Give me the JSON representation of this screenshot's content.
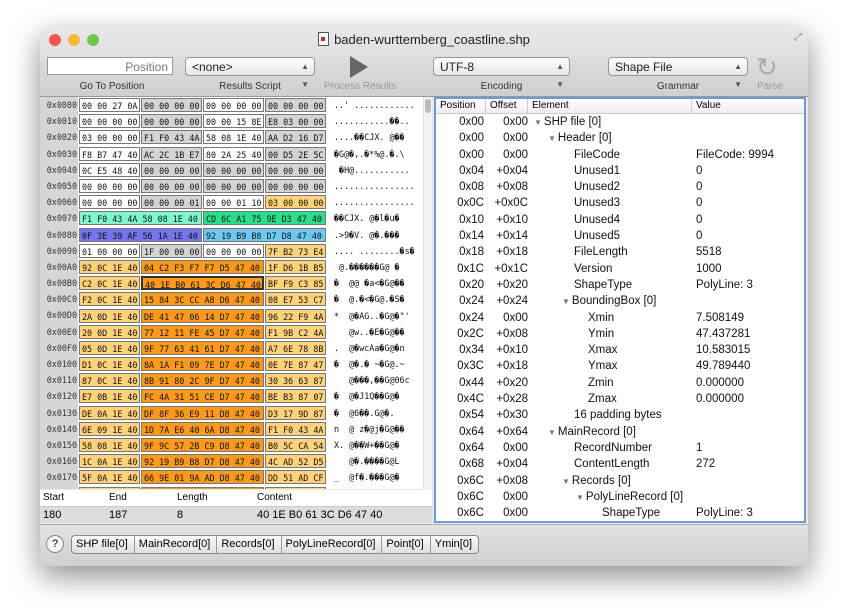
{
  "window": {
    "title": "baden-wurttemberg_coastline.shp"
  },
  "toolbar": {
    "position_placeholder": "Position",
    "go_to_label": "Go To Position",
    "results_script_value": "<none>",
    "results_script_label": "Results Script",
    "process_label": "Process Results",
    "encoding_value": "UTF-8",
    "encoding_label": "Encoding",
    "grammar_value": "Shape File",
    "grammar_label": "Grammar",
    "parse_label": "Parse"
  },
  "colors": {
    "w": "#ffffff",
    "g": "#d4d4d4",
    "y": "#fdd27a",
    "o": "#fb9a1a",
    "teal": "#80f5d2",
    "green": "#28e08c",
    "purple": "#7474ee",
    "lblue": "#70c8f2",
    "accent": "#6f9ad3"
  },
  "hex_rows": [
    {
      "addr": "0x0000",
      "groups": [
        "00 00 27 0A",
        "00 00 00 00",
        "00 00 00 00",
        "00 00 00 00"
      ],
      "colors": [
        "w",
        "g",
        "w",
        "g"
      ],
      "ascii": "..' ............"
    },
    {
      "addr": "0x0010",
      "groups": [
        "00 00 00 00",
        "00 00 00 00",
        "00 00 15 8E",
        "E8 03 00 00"
      ],
      "colors": [
        "w",
        "g",
        "w",
        "g"
      ],
      "ascii": "...........��.."
    },
    {
      "addr": "0x0020",
      "groups": [
        "03 00 00 00",
        "F1 F0 43 4A",
        "58 08 1E 40",
        "AA D2 16 D7"
      ],
      "colors": [
        "w",
        "g",
        "w",
        "g"
      ],
      "ascii": "....��CJX. @��"
    },
    {
      "addr": "0x0030",
      "groups": [
        "F8 B7 47 40",
        "AC 2C 1B E7",
        "80 2A 25 40",
        "00 D5 2E 5C"
      ],
      "colors": [
        "w",
        "g",
        "w",
        "g"
      ],
      "ascii": "�G@�,.�*%@.�.\\"
    },
    {
      "addr": "0x0040",
      "groups": [
        "0C E5 48 40",
        "00 00 00 00",
        "00 00 00 00",
        "00 00 00 00"
      ],
      "colors": [
        "w",
        "g",
        "g",
        "g"
      ],
      "ascii": " �H@..........."
    },
    {
      "addr": "0x0050",
      "groups": [
        "00 00 00 00",
        "00 00 00 00",
        "00 00 00 00",
        "00 00 00 00"
      ],
      "colors": [
        "w",
        "g",
        "g",
        "g"
      ],
      "ascii": "................"
    },
    {
      "addr": "0x0060",
      "groups": [
        "00 00 00 00",
        "00 00 00 01",
        "00 00 01 10",
        "03 00 00 00"
      ],
      "colors": [
        "w",
        "g",
        "w",
        "y"
      ],
      "ascii": "................"
    },
    {
      "addr": "0x0070",
      "groups": [
        "F1 F0 43 4A 58 08 1E 40",
        "CD 6C A1 75 9E D3 47 40"
      ],
      "colors": [
        "teal",
        "green"
      ],
      "ascii": "��CJX. @�l�u�"
    },
    {
      "addr": "0x0080",
      "groups": [
        "0F 3E 39 AF 56 1A 1E 40",
        "92 19 B9 B8 D7 D8 47 40"
      ],
      "colors": [
        "purple",
        "lblue"
      ],
      "ascii": ".>9�V. @�.���"
    },
    {
      "addr": "0x0090",
      "groups": [
        "01 00 00 00",
        "1F 00 00 00",
        "00 00 00 00",
        "7F B2 73 E4"
      ],
      "colors": [
        "w",
        "g",
        "w",
        "y"
      ],
      "ascii": ".... ........�s�"
    },
    {
      "addr": "0x00A0",
      "groups": [
        "92 0C 1E 40",
        "04 C2 F3 F7 F7 D5 47 40",
        "1F D6 1B B5"
      ],
      "colors": [
        "y",
        "o",
        "y"
      ],
      "ascii": " @.������G@ �"
    },
    {
      "addr": "0x00B0",
      "groups": [
        "C2 0C 1E 40",
        "40 1E B0 61 3C D6 47 40",
        "BF F9 C3 85"
      ],
      "colors": [
        "y",
        "o",
        "y"
      ],
      "ascii": "�  @@ �a<�G@��",
      "selected": true
    },
    {
      "addr": "0x00C0",
      "groups": [
        "F2 0C 1E 40",
        "15 84 3C CC A8 D6 47 40",
        "08 E7 53 C7"
      ],
      "colors": [
        "y",
        "o",
        "y"
      ],
      "ascii": "�  @.�<�G@.�S�"
    },
    {
      "addr": "0x00D0",
      "groups": [
        "2A 0D 1E 40",
        "DE 41 47 06 14 D7 47 40",
        "96 22 F9 4A"
      ],
      "colors": [
        "y",
        "o",
        "y"
      ],
      "ascii": "*  @�AG..�G@�\"'"
    },
    {
      "addr": "0x00E0",
      "groups": [
        "20 0D 1E 40",
        "77 12 11 FE 45 D7 47 40",
        "F1 9B C2 4A"
      ],
      "colors": [
        "y",
        "o",
        "y"
      ],
      "ascii": "   @w..�E�G@��"
    },
    {
      "addr": "0x00F0",
      "groups": [
        "05 0D 1E 40",
        "9F 77 63 41 61 D7 47 40",
        "A7 6E 78 8B"
      ],
      "colors": [
        "y",
        "o",
        "y"
      ],
      "ascii": ".  @�wcAa�G@�n"
    },
    {
      "addr": "0x0100",
      "groups": [
        "D1 0C 1E 40",
        "8A 1A F1 09 7E D7 47 40",
        "0E 7E 87 47"
      ],
      "colors": [
        "y",
        "o",
        "y"
      ],
      "ascii": "�  @�.� ~�G@.~"
    },
    {
      "addr": "0x0110",
      "groups": [
        "87 0C 1E 40",
        "8B 91 80 2C 9F D7 47 40",
        "30 36 63 87"
      ],
      "colors": [
        "y",
        "o",
        "y"
      ],
      "ascii": "   @���,��G@06c"
    },
    {
      "addr": "0x0120",
      "groups": [
        "E7 0B 1E 40",
        "FC 4A 31 51 CE D7 47 40",
        "BE B3 87 07"
      ],
      "colors": [
        "y",
        "o",
        "y"
      ],
      "ascii": "�  @�J1Q��G@�"
    },
    {
      "addr": "0x0130",
      "groups": [
        "DE 0A 1E 40",
        "DF 8F 36 E9 11 D8 47 40",
        "D3 17 9D 87"
      ],
      "colors": [
        "y",
        "o",
        "y"
      ],
      "ascii": "�  @6��.G@�."
    },
    {
      "addr": "0x0140",
      "groups": [
        "6E 09 1E 40",
        "1D 7A E6 40 6A D8 47 40",
        "F1 F0 43 4A"
      ],
      "colors": [
        "y",
        "o",
        "y"
      ],
      "ascii": "n  @ z�@j�G@��"
    },
    {
      "addr": "0x0150",
      "groups": [
        "58 08 1E 40",
        "9F 9C 57 2B C9 D8 47 40",
        "B0 5C CA 54"
      ],
      "colors": [
        "y",
        "o",
        "y"
      ],
      "ascii": "X. @��W+��G@�"
    },
    {
      "addr": "0x0160",
      "groups": [
        "1C 0A 1E 40",
        "92 19 B9 B8 D7 D8 47 40",
        "4C AD 52 D5"
      ],
      "colors": [
        "y",
        "o",
        "y"
      ],
      "ascii": "   @�.����G@L"
    },
    {
      "addr": "0x0170",
      "groups": [
        "5F 0A 1E 40",
        "66 9E 01 9A AD D8 47 40",
        "DD 51 AD CF"
      ],
      "colors": [
        "y",
        "o",
        "y"
      ],
      "ascii": "_  @f�.���G@�"
    },
    {
      "addr": "0x0180",
      "groups": [
        "E6 0A 1E 40",
        "E4 E4 34 FA 87 D8 47 40",
        "F5 17 D5 7D"
      ],
      "colors": [
        "y",
        "o",
        "y"
      ],
      "ascii": "�  @��4��G@."
    }
  ],
  "tree": {
    "headers": [
      "Position",
      "Offset",
      "Element",
      "Value"
    ],
    "rows": [
      {
        "pos": "0x00",
        "off": "0x00",
        "name": "SHP file [0]",
        "value": "",
        "level": 0,
        "expanded": true
      },
      {
        "pos": "0x00",
        "off": "0x00",
        "name": "Header [0]",
        "value": "",
        "level": 1,
        "expanded": true
      },
      {
        "pos": "0x00",
        "off": "0x00",
        "name": "FileCode",
        "value": "FileCode: 9994",
        "level": 2
      },
      {
        "pos": "0x04",
        "off": "+0x04",
        "name": "Unused1",
        "value": "0",
        "level": 2
      },
      {
        "pos": "0x08",
        "off": "+0x08",
        "name": "Unused2",
        "value": "0",
        "level": 2
      },
      {
        "pos": "0x0C",
        "off": "+0x0C",
        "name": "Unused3",
        "value": "0",
        "level": 2
      },
      {
        "pos": "0x10",
        "off": "+0x10",
        "name": "Unused4",
        "value": "0",
        "level": 2
      },
      {
        "pos": "0x14",
        "off": "+0x14",
        "name": "Unused5",
        "value": "0",
        "level": 2
      },
      {
        "pos": "0x18",
        "off": "+0x18",
        "name": "FileLength",
        "value": "5518",
        "level": 2
      },
      {
        "pos": "0x1C",
        "off": "+0x1C",
        "name": "Version",
        "value": "1000",
        "level": 2
      },
      {
        "pos": "0x20",
        "off": "+0x20",
        "name": "ShapeType",
        "value": "PolyLine: 3",
        "level": 2
      },
      {
        "pos": "0x24",
        "off": "+0x24",
        "name": "BoundingBox [0]",
        "value": "",
        "level": 2,
        "expanded": true
      },
      {
        "pos": "0x24",
        "off": "0x00",
        "name": "Xmin",
        "value": "7.508149",
        "level": 3
      },
      {
        "pos": "0x2C",
        "off": "+0x08",
        "name": "Ymin",
        "value": "47.437281",
        "level": 3
      },
      {
        "pos": "0x34",
        "off": "+0x10",
        "name": "Xmax",
        "value": "10.583015",
        "level": 3
      },
      {
        "pos": "0x3C",
        "off": "+0x18",
        "name": "Ymax",
        "value": "49.789440",
        "level": 3
      },
      {
        "pos": "0x44",
        "off": "+0x20",
        "name": "Zmin",
        "value": "0.000000",
        "level": 3
      },
      {
        "pos": "0x4C",
        "off": "+0x28",
        "name": "Zmax",
        "value": "0.000000",
        "level": 3
      },
      {
        "pos": "0x54",
        "off": "+0x30",
        "name": "16 padding bytes",
        "value": "",
        "level": 2
      },
      {
        "pos": "0x64",
        "off": "+0x64",
        "name": "MainRecord [0]",
        "value": "",
        "level": 1,
        "expanded": true
      },
      {
        "pos": "0x64",
        "off": "0x00",
        "name": "RecordNumber",
        "value": "1",
        "level": 2
      },
      {
        "pos": "0x68",
        "off": "+0x04",
        "name": "ContentLength",
        "value": "272",
        "level": 2
      },
      {
        "pos": "0x6C",
        "off": "+0x08",
        "name": "Records [0]",
        "value": "",
        "level": 2,
        "expanded": true
      },
      {
        "pos": "0x6C",
        "off": "0x00",
        "name": "PolyLineRecord [0]",
        "value": "",
        "level": 3,
        "expanded": true
      },
      {
        "pos": "0x6C",
        "off": "0x00",
        "name": "ShapeType",
        "value": "PolyLine: 3",
        "level": 4
      }
    ]
  },
  "selection": {
    "headers": [
      "Start",
      "End",
      "Length",
      "Content"
    ],
    "start": "180",
    "end": "187",
    "length": "8",
    "content": "40 1E B0 61 3C D6 47 40"
  },
  "breadcrumbs": [
    "SHP file[0]",
    "MainRecord[0]",
    "Records[0]",
    "PolyLineRecord[0]",
    "Point[0]",
    "Ymin[0]"
  ],
  "help_label": "?"
}
